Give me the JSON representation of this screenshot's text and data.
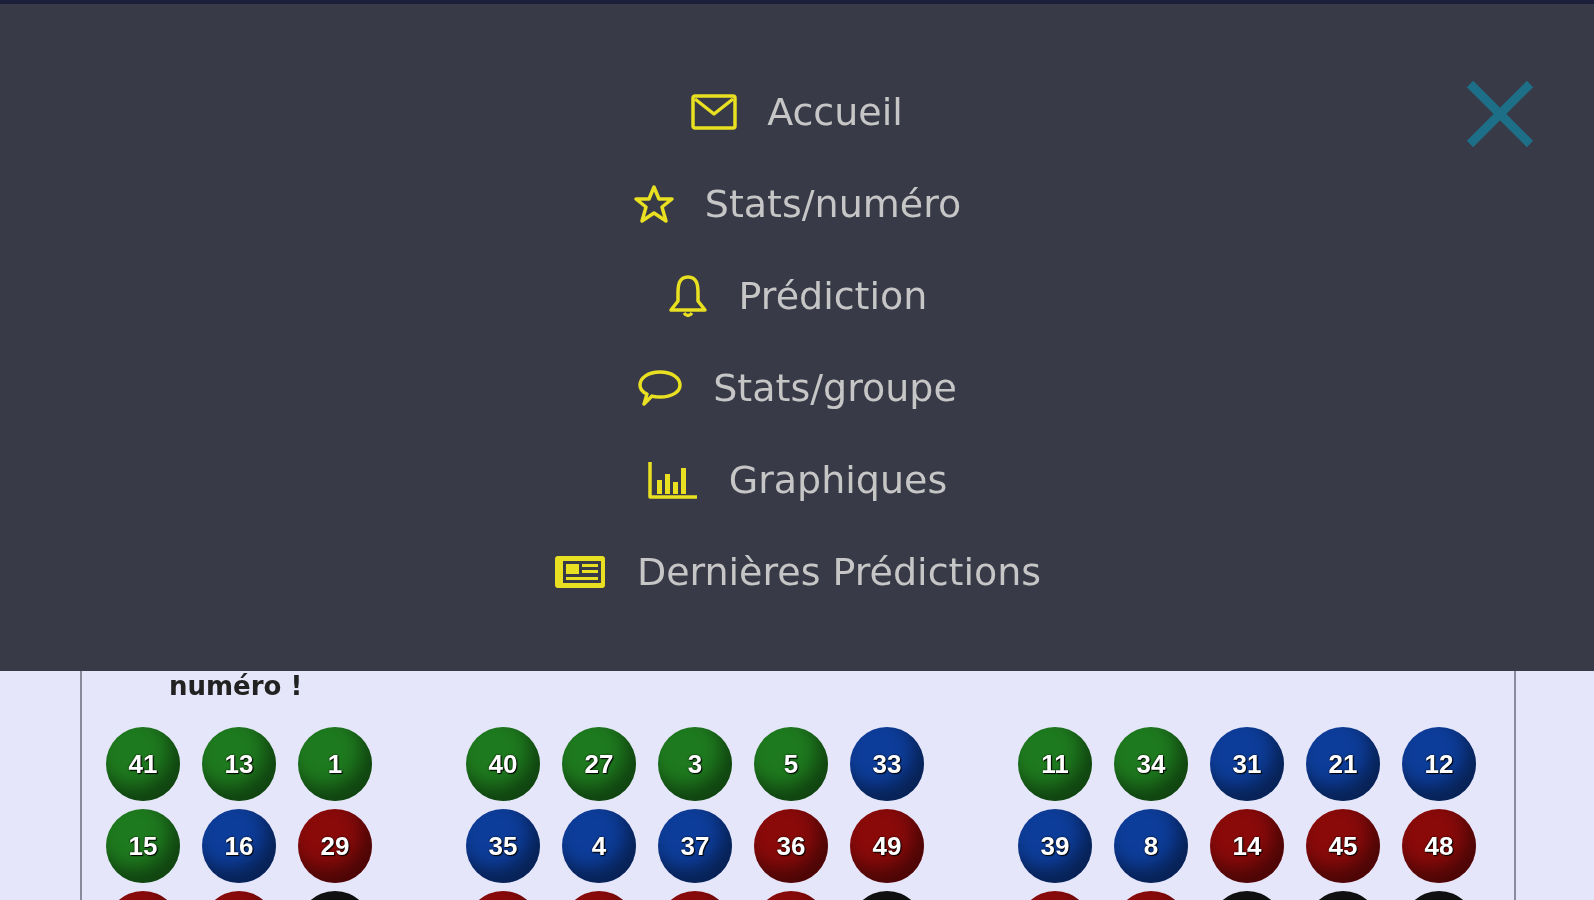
{
  "menu": {
    "items": [
      {
        "label": "Accueil",
        "kind": "envelope"
      },
      {
        "label": "Stats/numéro",
        "kind": "star"
      },
      {
        "label": "Prédiction",
        "kind": "bell"
      },
      {
        "label": "Stats/groupe",
        "kind": "comment"
      },
      {
        "label": "Graphiques",
        "kind": "chart"
      },
      {
        "label": "Dernières Prédictions",
        "kind": "newspaper"
      }
    ]
  },
  "heading": "numéro !",
  "groups": [
    {
      "rows": [
        [
          {
            "number": "41",
            "color": "#1e7a1e"
          },
          {
            "number": "13",
            "color": "#1e7a1e"
          },
          {
            "number": "1",
            "color": "#1e7a1e"
          }
        ],
        [
          {
            "number": "15",
            "color": "#1e7a1e"
          },
          {
            "number": "16",
            "color": "#0d3d9a"
          },
          {
            "number": "29",
            "color": "#8a0a0a"
          }
        ],
        [
          {
            "color": "#8a0a0a"
          },
          {
            "color": "#8a0a0a"
          },
          {
            "color": "#111111"
          }
        ]
      ]
    },
    {
      "rows": [
        [
          {
            "number": "40",
            "color": "#1e7a1e"
          },
          {
            "number": "27",
            "color": "#1e7a1e"
          },
          {
            "number": "3",
            "color": "#1e7a1e"
          },
          {
            "number": "5",
            "color": "#1e7a1e"
          },
          {
            "number": "33",
            "color": "#0d3d9a"
          }
        ],
        [
          {
            "number": "35",
            "color": "#0d3d9a"
          },
          {
            "number": "4",
            "color": "#0d3d9a"
          },
          {
            "number": "37",
            "color": "#0d3d9a"
          },
          {
            "number": "36",
            "color": "#8a0a0a"
          },
          {
            "number": "49",
            "color": "#8a0a0a"
          }
        ],
        [
          {
            "color": "#8a0a0a"
          },
          {
            "color": "#8a0a0a"
          },
          {
            "color": "#8a0a0a"
          },
          {
            "color": "#8a0a0a"
          },
          {
            "color": "#111111"
          }
        ]
      ]
    },
    {
      "rows": [
        [
          {
            "number": "11",
            "color": "#1e7a1e"
          },
          {
            "number": "34",
            "color": "#1e7a1e"
          },
          {
            "number": "31",
            "color": "#0d3d9a"
          },
          {
            "number": "21",
            "color": "#0d3d9a"
          },
          {
            "number": "12",
            "color": "#0d3d9a"
          }
        ],
        [
          {
            "number": "39",
            "color": "#0d3d9a"
          },
          {
            "number": "8",
            "color": "#0d3d9a"
          },
          {
            "number": "14",
            "color": "#8a0a0a"
          },
          {
            "number": "45",
            "color": "#8a0a0a"
          },
          {
            "number": "48",
            "color": "#8a0a0a"
          }
        ],
        [
          {
            "color": "#8a0a0a"
          },
          {
            "color": "#8a0a0a"
          },
          {
            "color": "#111111"
          },
          {
            "color": "#111111"
          },
          {
            "color": "#111111"
          }
        ]
      ]
    }
  ]
}
